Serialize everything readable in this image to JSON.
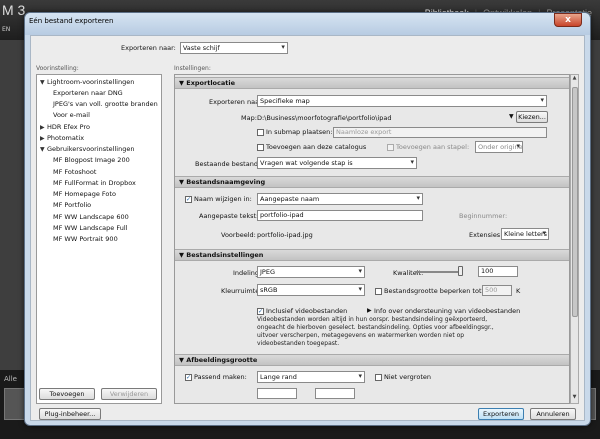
{
  "lightroom": {
    "logo": "M 3",
    "nav": [
      "Bibliotheek",
      "Ontwikkelen",
      "Presentatie"
    ],
    "left_label": "EN",
    "alle": "Alle"
  },
  "dialog": {
    "title": "Eén bestand exporteren",
    "close": "x",
    "export_to_label": "Exporteren naar:",
    "export_to_value": "Vaste schijf"
  },
  "presets": {
    "label": "Voorinstelling:",
    "items": [
      {
        "label": "Lightroom-voorinstellingen",
        "kind": "group-open"
      },
      {
        "label": "Exporteren naar DNG",
        "kind": "item"
      },
      {
        "label": "JPEG's van voll. grootte branden",
        "kind": "item"
      },
      {
        "label": "Voor e-mail",
        "kind": "item"
      },
      {
        "label": "HDR Efex Pro",
        "kind": "group-closed"
      },
      {
        "label": "Photomatix",
        "kind": "group-closed"
      },
      {
        "label": "Gebruikersvoorinstellingen",
        "kind": "group-open"
      },
      {
        "label": "MF Blogpost Image 200",
        "kind": "item"
      },
      {
        "label": "MF Fotoshoot",
        "kind": "item"
      },
      {
        "label": "MF FullFormat in Dropbox",
        "kind": "item"
      },
      {
        "label": "MF Homepage Foto",
        "kind": "item"
      },
      {
        "label": "MF Portfolio",
        "kind": "item"
      },
      {
        "label": "MF WW Landscape 600",
        "kind": "item"
      },
      {
        "label": "MF WW Landscape Full",
        "kind": "item"
      },
      {
        "label": "MF WW Portrait 900",
        "kind": "item"
      }
    ],
    "add_button": "Toevoegen",
    "remove_button": "Verwijderen"
  },
  "settings": {
    "label": "Instellingen:",
    "export_location": {
      "title": "Exportlocatie",
      "export_to_label": "Exporteren naar:",
      "export_to_value": "Specifieke map",
      "folder_label": "Map:",
      "folder_value": "D:\\Business\\moorfotografie\\portfolio\\ipad",
      "choose_button": "Kiezen...",
      "subfolder_label": "In submap plaatsen:",
      "subfolder_placeholder": "Naamloze export",
      "catalog_label": "Toevoegen aan deze catalogus",
      "stack_label": "Toevoegen aan stapel:",
      "stack_value": "Onder origineel",
      "existing_label": "Bestaande bestanden:",
      "existing_value": "Vragen wat volgende stap is"
    },
    "file_naming": {
      "title": "Bestandsnaamgeving",
      "rename_label": "Naam wijzigen in:",
      "rename_value": "Aangepaste naam",
      "custom_text_label": "Aangepaste tekst:",
      "custom_text_value": "portfolio-ipad",
      "start_number_label": "Beginnummer:",
      "example_label": "Voorbeeld:",
      "example_value": "portfolio-ipad.jpg",
      "extensions_label": "Extensies:",
      "extensions_value": "Kleine letters"
    },
    "file_settings": {
      "title": "Bestandsinstellingen",
      "format_label": "Indeling:",
      "format_value": "JPEG",
      "quality_label": "Kwaliteit:",
      "quality_value": "100",
      "quality_fraction": 1.0,
      "colorspace_label": "Kleurruimte:",
      "colorspace_value": "sRGB",
      "limit_size_label": "Bestandsgrootte beperken tot:",
      "limit_size_value": "500",
      "limit_size_unit": "K",
      "include_video_label": "Inclusief videobestanden",
      "video_info_label": "Info over ondersteuning van videobestanden",
      "video_note": "Videobestanden worden altijd in hun oorspr. bestandsindeling geëxporteerd, ongeacht de hierboven geselect. bestandsindeling. Opties voor afbeeldingsgr., uitvoer verscherpen, metagegevens en watermerken worden niet op videobestanden toegepast."
    },
    "image_sizing": {
      "title": "Afbeeldingsgrootte",
      "resize_label": "Passend maken:",
      "resize_value": "Lange rand",
      "dont_enlarge_label": "Niet vergroten"
    }
  },
  "footer": {
    "plugin_button": "Plug-inbeheer...",
    "export_button": "Exporteren",
    "cancel_button": "Annuleren"
  }
}
